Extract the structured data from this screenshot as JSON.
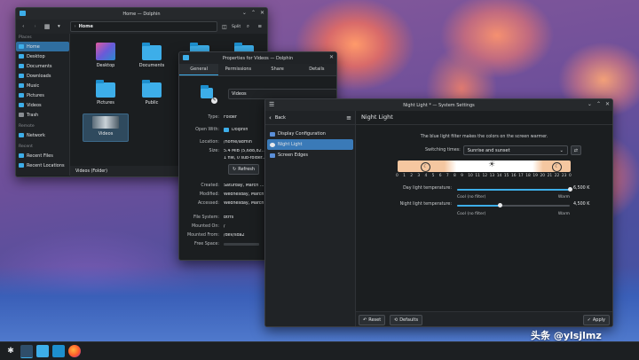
{
  "dolphin": {
    "title": "Home — Dolphin",
    "split_label": "Split",
    "breadcrumb": "Home",
    "places_header": "Places",
    "places": [
      "Home",
      "Desktop",
      "Documents",
      "Downloads",
      "Music",
      "Pictures",
      "Videos",
      "Trash"
    ],
    "remote_header": "Remote",
    "remote": [
      "Network"
    ],
    "recent_header": "Recent",
    "recent": [
      "Recent Files",
      "Recent Locations"
    ],
    "folders": [
      "Desktop",
      "Documents",
      "",
      "",
      "Pictures",
      "Public",
      "Videos"
    ],
    "status": "Videos (Folder)"
  },
  "properties": {
    "title": "Properties for Videos — Dolphin",
    "tabs": [
      "General",
      "Permissions",
      "Share",
      "Details"
    ],
    "name_value": "Videos",
    "rows": [
      {
        "k": "Type:",
        "v": "Folder"
      },
      {
        "k": "Open With:",
        "v": "Dolphin"
      },
      {
        "k": "Location:",
        "v": "/home/admin"
      },
      {
        "k": "Size:",
        "v": "5.4 MiB (5,688,82..."
      },
      {
        "k": "",
        "v": "1 file, 0 sub-folder..."
      }
    ],
    "refresh_label": "Refresh",
    "rows2": [
      {
        "k": "Created:",
        "v": "Saturday, March ..."
      },
      {
        "k": "Modified:",
        "v": "Wednesday, March ..."
      },
      {
        "k": "Accessed:",
        "v": "Wednesday, March ..."
      }
    ],
    "rows3": [
      {
        "k": "File System:",
        "v": "btrfs"
      },
      {
        "k": "Mounted On:",
        "v": "/"
      },
      {
        "k": "Mounted From:",
        "v": "/dev/sda2"
      },
      {
        "k": "Free Space:",
        "v": ""
      }
    ]
  },
  "settings": {
    "title": "Night Light * — System Settings",
    "back_label": "Back",
    "nav": [
      "Display Configuration",
      "Night Light",
      "Screen Edges"
    ],
    "page_title": "Night Light",
    "description": "The blue light filter makes the colors on the screen warmer.",
    "switch_label": "Switching times:",
    "switch_value": "Sunrise and sunset",
    "hours": [
      "0",
      "1",
      "2",
      "3",
      "4",
      "5",
      "6",
      "7",
      "8",
      "9",
      "10",
      "11",
      "12",
      "13",
      "14",
      "15",
      "16",
      "17",
      "18",
      "19",
      "20",
      "21",
      "22",
      "23",
      "0"
    ],
    "day_label": "Day light temperature:",
    "day_value": "6,500 K",
    "day_fraction": 1.0,
    "night_label": "Night light temperature:",
    "night_value": "4,500 K",
    "night_fraction": 0.38,
    "cool_label": "Cool (no filter)",
    "warm_label": "Warm",
    "reset_label": "Reset",
    "defaults_label": "Defaults",
    "apply_label": "Apply"
  },
  "watermark": "头条 @ylsjlmz",
  "colors": {
    "accent": "#3daee9",
    "panel": "#1b1e20"
  }
}
